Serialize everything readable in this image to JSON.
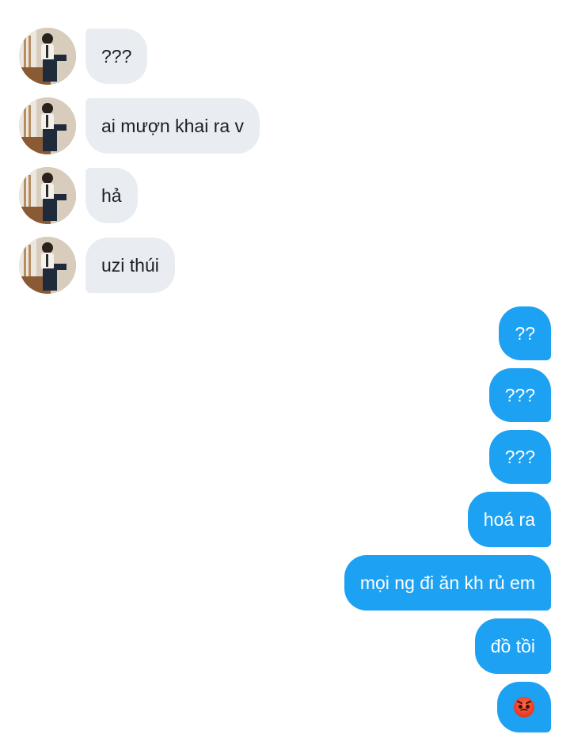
{
  "conversation": {
    "incoming": [
      {
        "text": "???"
      },
      {
        "text": "ai mượn khai ra v"
      },
      {
        "text": "hả"
      },
      {
        "text": "uzi thúi"
      }
    ],
    "outgoing": [
      {
        "text": "??"
      },
      {
        "text": "???"
      },
      {
        "text": "???"
      },
      {
        "text": "hoá ra"
      },
      {
        "text": "mọi ng đi ăn kh rủ em"
      },
      {
        "text": "đồ tồi"
      },
      {
        "emoji": "angry-face"
      }
    ]
  },
  "colors": {
    "incoming_bubble": "#e9edf1",
    "outgoing_bubble": "#1da1f2",
    "incoming_text": "#1b1f24",
    "outgoing_text": "#ffffff"
  }
}
